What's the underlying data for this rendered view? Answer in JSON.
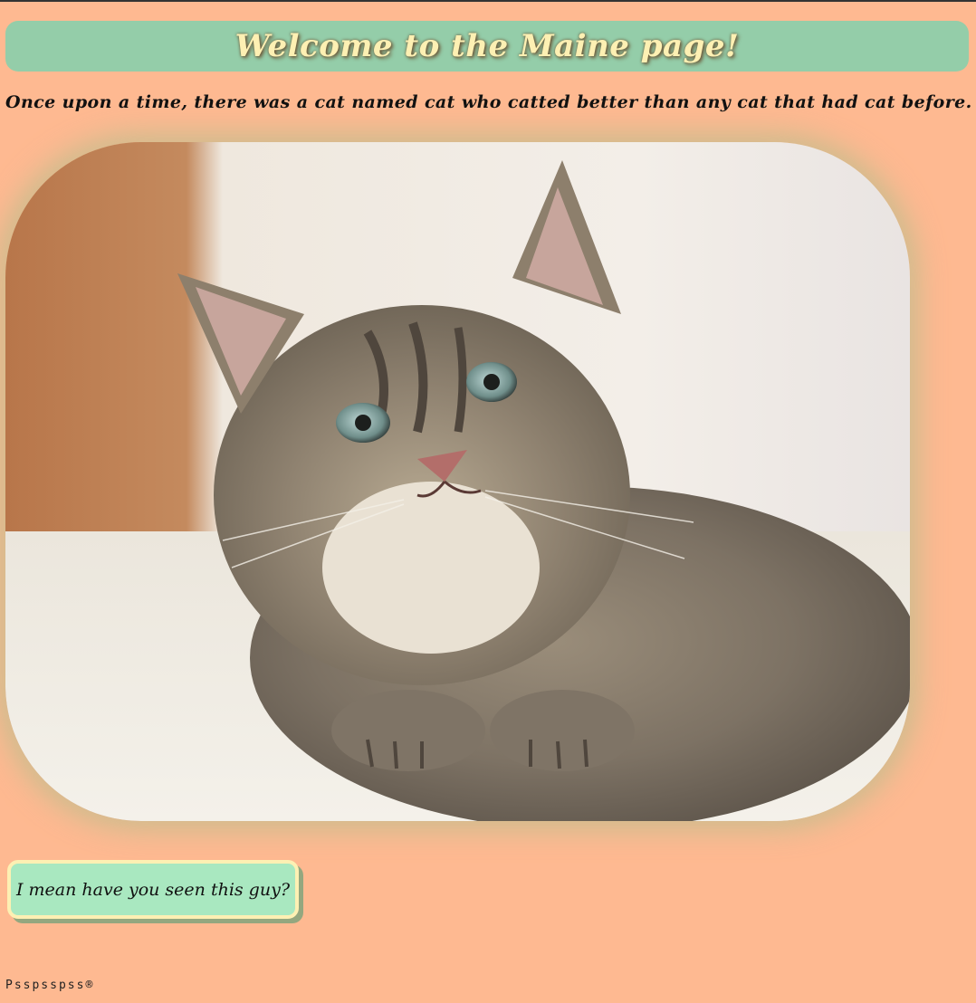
{
  "header": {
    "title": "Welcome to the Maine page!"
  },
  "intro": {
    "text": "Once upon a time, there was a cat named cat who catted better than any cat that had cat before."
  },
  "photo": {
    "subject": "kitten-photo"
  },
  "cta": {
    "label": "I mean have you seen this guy?"
  },
  "footer": {
    "text": "Psspsspss®"
  },
  "colors": {
    "background": "#feb991",
    "header_bg": "#94cda9",
    "title_text": "#fdf0b3",
    "button_bg": "#a9e8c0",
    "button_border": "#fdf0b3"
  }
}
